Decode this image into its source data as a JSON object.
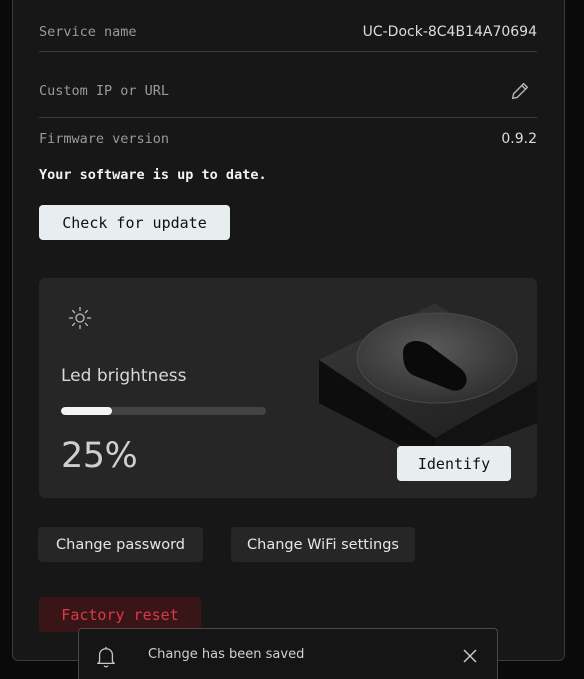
{
  "service": {
    "label": "Service name",
    "value": "UC-Dock-8C4B14A70694"
  },
  "custom_ip": {
    "label": "Custom IP or URL",
    "edit_icon": "pencil-icon"
  },
  "firmware": {
    "label": "Firmware version",
    "value": "0.9.2",
    "status": "Your software is up to date.",
    "check_label": "Check for update"
  },
  "led": {
    "icon": "sun-icon",
    "label": "Led brightness",
    "level": 0.25,
    "value_text": "25%",
    "identify_label": "Identify"
  },
  "actions": {
    "change_password": "Change password",
    "change_wifi": "Change WiFi settings",
    "factory_reset": "Factory reset"
  },
  "toast": {
    "icon": "bell-icon",
    "message": "Change has been saved",
    "close_icon": "close-icon"
  },
  "colors": {
    "danger": "#d93a44",
    "danger_bg": "#3a1518",
    "button_light": "#e8eef0",
    "card_bg": "#262626"
  }
}
